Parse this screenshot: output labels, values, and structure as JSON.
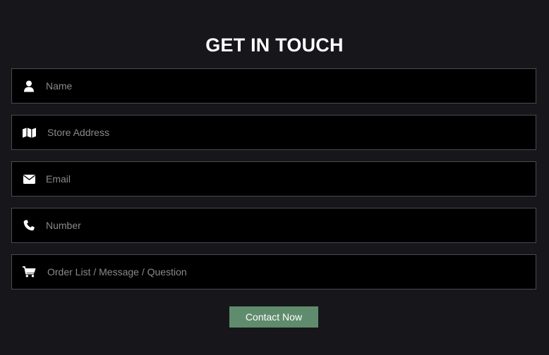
{
  "form": {
    "title": "GET IN TOUCH",
    "fields": [
      {
        "icon": "user-icon",
        "placeholder": "Name",
        "value": ""
      },
      {
        "icon": "map-icon",
        "placeholder": "Store Address",
        "value": ""
      },
      {
        "icon": "envelope-icon",
        "placeholder": "Email",
        "value": ""
      },
      {
        "icon": "phone-icon",
        "placeholder": "Number",
        "value": ""
      },
      {
        "icon": "shopping-cart-icon",
        "placeholder": "Order List / Message / Question",
        "value": ""
      }
    ],
    "submit_label": "Contact Now"
  },
  "colors": {
    "background": "#16161b",
    "field_background": "#000000",
    "field_border": "#4a4a50",
    "button": "#5f8c6c",
    "text": "#ffffff"
  }
}
